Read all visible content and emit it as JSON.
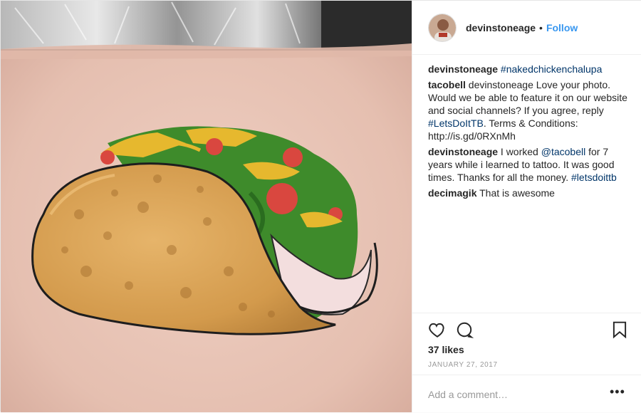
{
  "header": {
    "username": "devinstoneage",
    "separator": "•",
    "follow_label": "Follow"
  },
  "caption": {
    "user": "devinstoneage",
    "hashtag": "#nakedchickenchalupa"
  },
  "comments": [
    {
      "user": "tacobell",
      "text_before": "devinstoneage Love your photo. Would we be able to feature it on our website and social channels? If you agree, reply ",
      "link": "#LetsDoItTB",
      "text_after": ". Terms & Conditions: http://is.gd/0RXnMh"
    },
    {
      "user": "devinstoneage",
      "text_before": "I worked ",
      "link": "@tacobell",
      "text_middle": " for 7 years while i learned to tattoo. It was good times. Thanks for all the money. ",
      "link2": "#letsdoittb"
    },
    {
      "user": "decimagik",
      "text_before": "That is awesome"
    }
  ],
  "actions": {
    "likes": "37 likes",
    "date": "JANUARY 27, 2017",
    "add_comment_placeholder": "Add a comment…",
    "more": "•••"
  },
  "icons": {
    "like": "heart-icon",
    "comment": "comment-bubble-icon",
    "save": "bookmark-icon",
    "more": "ellipsis-icon"
  },
  "colors": {
    "follow": "#3897f0",
    "link": "#003569",
    "muted": "#999999",
    "skin": "#e8c4b6",
    "shell": "#d9a45a",
    "lettuce": "#3e8b2b",
    "tomato": "#d9473f",
    "cheese": "#e6b82e"
  }
}
